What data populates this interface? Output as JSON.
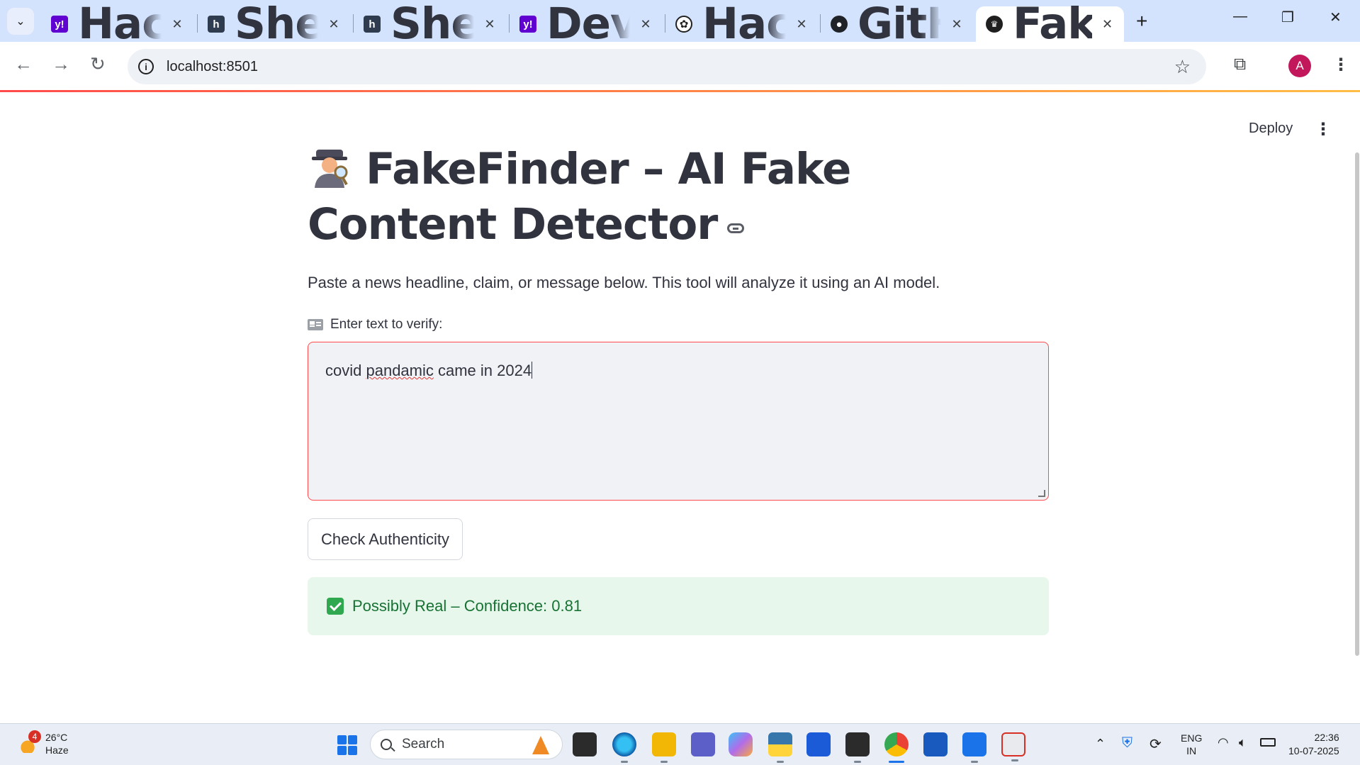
{
  "browser": {
    "tabs": [
      {
        "title": "HackerEarth Shell",
        "favicon": "yahoo-icon",
        "active": false
      },
      {
        "title": "Shell.ai Hackathon",
        "favicon": "hackerearth-icon",
        "active": false
      },
      {
        "title": "Shell.ai Hackathon",
        "favicon": "hackerearth-icon",
        "active": false
      },
      {
        "title": "Devpost Virtual",
        "favicon": "yahoo-icon",
        "active": false
      },
      {
        "title": "Hackathon certificate",
        "favicon": "chatgpt-icon",
        "active": false
      },
      {
        "title": "GitHub · Build and",
        "favicon": "github-icon",
        "active": false
      },
      {
        "title": "FakeFinder",
        "favicon": "streamlit-icon",
        "active": true
      }
    ],
    "url": "localhost:8501",
    "profile_initial": "A",
    "accent": "#d3e3fd"
  },
  "header": {
    "deploy_label": "Deploy"
  },
  "page": {
    "title": "FakeFinder – AI Fake Content Detector",
    "subtitle": "Paste a news headline, claim, or message below. This tool will analyze it using an AI model.",
    "input_label": "Enter text to verify:",
    "input_value_before": "covid ",
    "input_value_misspelled": "pandamic",
    "input_value_after": " came in 2024",
    "button_label": "Check Authenticity",
    "result_text": "Possibly Real – Confidence: 0.81",
    "colors": {
      "primary": "#ff4b4b",
      "success_bg": "#e7f7ec",
      "success_text": "#177233"
    }
  },
  "taskbar": {
    "weather_temp": "26°C",
    "weather_desc": "Haze",
    "weather_badge": "4",
    "search_label": "Search",
    "lang_line1": "ENG",
    "lang_line2": "IN",
    "time": "22:36",
    "date": "10-07-2025"
  }
}
